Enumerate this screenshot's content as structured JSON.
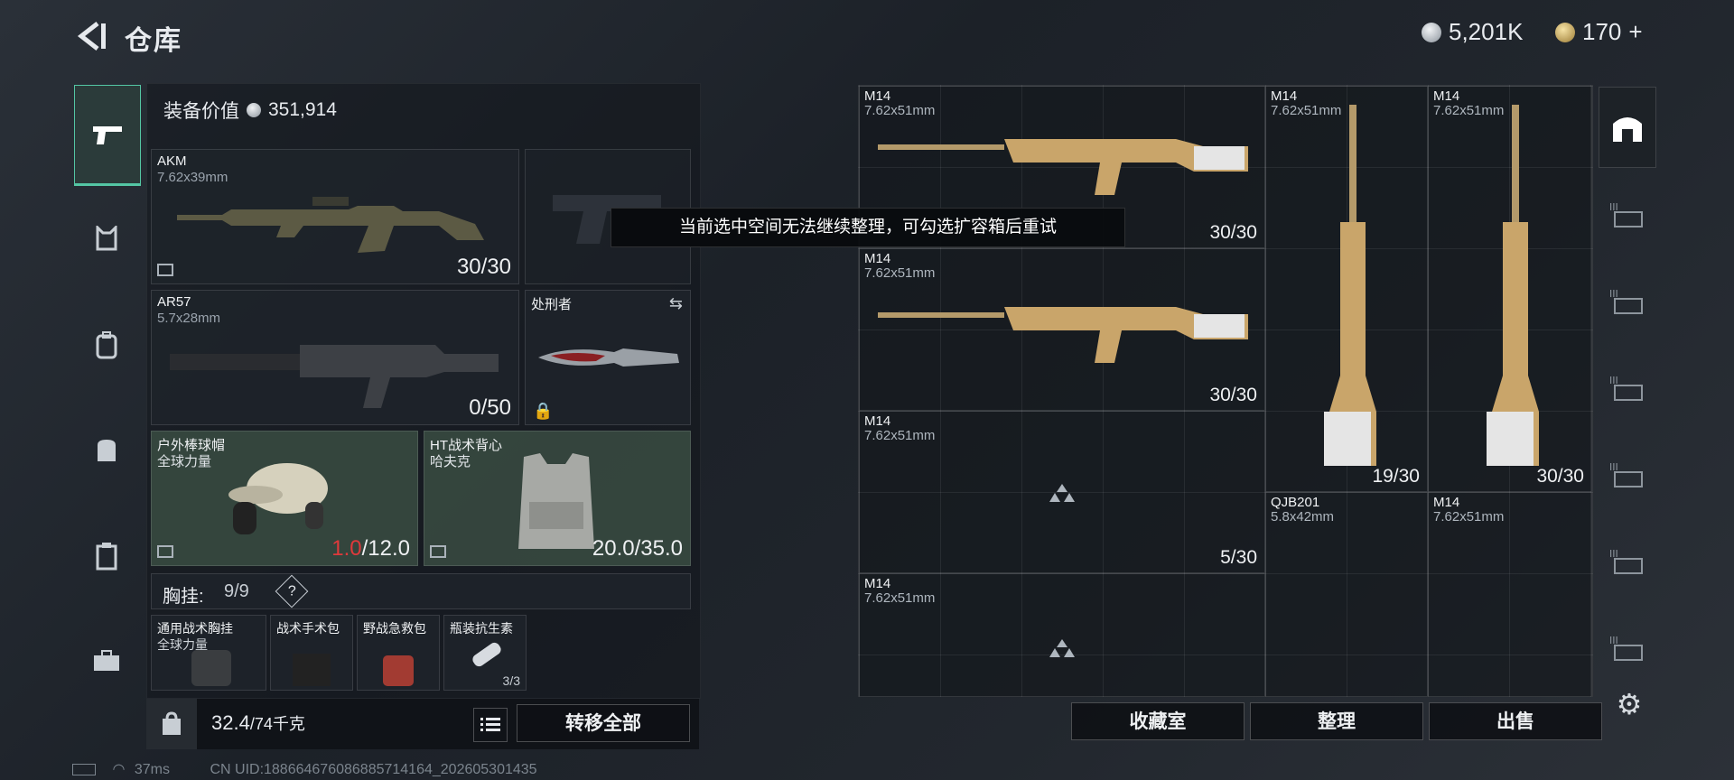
{
  "header": {
    "back_icon": "back-arrow-icon",
    "title": "仓库",
    "currency_silver": "5,201K",
    "currency_gold": "170",
    "gold_add": "+"
  },
  "rail": [
    "pistol-icon",
    "armor-icon",
    "backpack-icon",
    "bag-icon",
    "case-icon",
    "toolbox-icon"
  ],
  "equipment": {
    "value_label": "装备价值",
    "value": "351,914",
    "primary1": {
      "name": "AKM",
      "caliber": "7.62x39mm",
      "ammo": "30/30"
    },
    "primary2": {
      "name": "AR57",
      "caliber": "5.7x28mm",
      "ammo": "0/50"
    },
    "melee": {
      "name": "处刑者"
    },
    "helmet": {
      "name": "户外棒球帽",
      "brand": "全球力量",
      "durability_current": "1.0",
      "durability_max": "/12.0"
    },
    "armor": {
      "name": "HT战术背心",
      "brand": "哈夫克",
      "durability": "20.0/35.0"
    },
    "rig_label": "胸挂:",
    "rig_value": "9/9",
    "rig_help": "?",
    "rig_items": [
      {
        "name": "通用战术胸挂",
        "brand": "全球力量"
      },
      {
        "name": "战术手术包"
      },
      {
        "name": "野战急救包"
      },
      {
        "name": "瓶装抗生素",
        "extra": "3/3"
      }
    ]
  },
  "weight": {
    "value": "32.4",
    "max": "/74千克"
  },
  "transfer_all": "转移全部",
  "tooltip": "当前选中空间无法继续整理，可勾选扩容箱后重试",
  "storage": [
    {
      "name": "M14",
      "caliber": "7.62x51mm",
      "ammo": "30/30"
    },
    {
      "name": "M14",
      "caliber": "7.62x51mm",
      "ammo": "30/30"
    },
    {
      "name": "M14",
      "caliber": "7.62x51mm",
      "ammo": "5/30"
    },
    {
      "name": "M14",
      "caliber": "7.62x51mm",
      "ammo": ""
    },
    {
      "name": "M14",
      "caliber": "7.62x51mm",
      "ammo": "19/30"
    },
    {
      "name": "M14",
      "caliber": "7.62x51mm",
      "ammo": "30/30"
    },
    {
      "name": "QJB201",
      "caliber": "5.8x42mm",
      "ammo": ""
    },
    {
      "name": "M14",
      "caliber": "7.62x51mm",
      "ammo": ""
    }
  ],
  "actions": {
    "collection": "收藏室",
    "organize": "整理",
    "sell": "出售"
  },
  "right_rail": [
    "warehouse-icon",
    "case-3-icon",
    "case-3-icon",
    "case-3-icon",
    "case-3-icon",
    "case-3-icon",
    "case-3-icon",
    "settings-icon"
  ],
  "footer": {
    "ping": "37ms",
    "uid": "CN UID:18866467608688571​4164_202605301435"
  }
}
